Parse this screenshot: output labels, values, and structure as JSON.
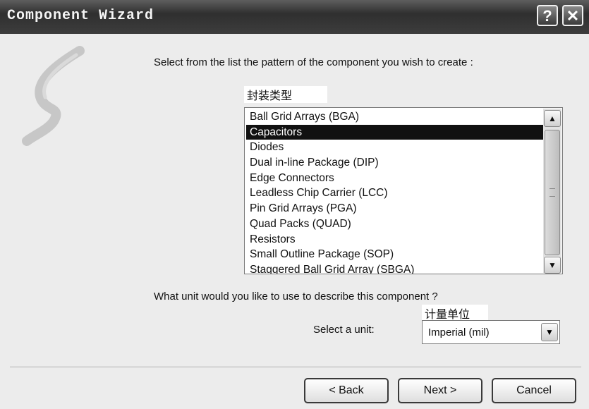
{
  "window": {
    "title": "Component Wizard",
    "help_glyph": "?",
    "close_glyph": "✕"
  },
  "prompt": "Select from the list the pattern of the component you wish to create :",
  "pattern_label_cn": "封装类型",
  "patterns": {
    "items": [
      "Ball Grid Arrays (BGA)",
      "Capacitors",
      "Diodes",
      "Dual in-line Package (DIP)",
      "Edge Connectors",
      "Leadless Chip Carrier (LCC)",
      "Pin Grid Arrays (PGA)",
      "Quad Packs (QUAD)",
      "Resistors",
      "Small Outline Package (SOP)",
      "Staggered Ball Grid Array (SBGA)"
    ],
    "selected": "Capacitors"
  },
  "unit_question": "What unit would you like to use to describe this component ?",
  "unit_label_cn": "计量单位",
  "unit_select_label": "Select a unit:",
  "unit_value": "Imperial (mil)",
  "buttons": {
    "back": "< Back",
    "next": "Next >",
    "cancel": "Cancel"
  },
  "icons": {
    "help": "help-icon",
    "close": "close-icon",
    "scroll_up": "chevron-up-icon",
    "scroll_down": "chevron-down-icon",
    "combo": "chevron-down-icon",
    "wizard_logo": "wizard-swoosh-icon"
  }
}
